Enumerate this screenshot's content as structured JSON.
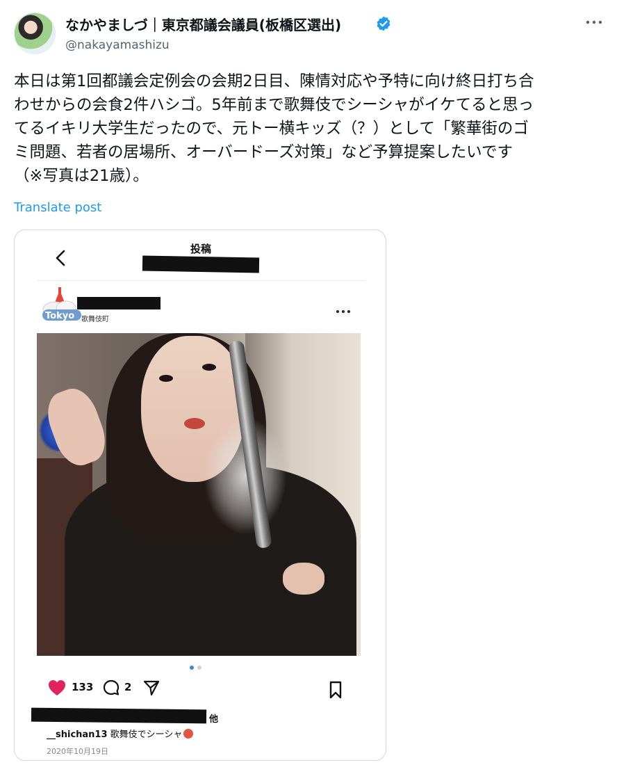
{
  "tweet": {
    "display_name": "なかやましづ｜東京都議会議員(板橋区選出)",
    "handle": "@nakayamashizu",
    "text_lines": [
      "本日は第1回都議会定例会の会期2日目、陳情対応や予特に向け終日打ち合",
      "わせからの会食2件ハシゴ。5年前まで歌舞伎でシーシャがイケてると思っ",
      "てるイキリ大学生だったので、元トー横キッズ（？）として「繁華街のゴ",
      "ミ問題、若者の居場所、オーバードーズ対策」など予算提案したいです",
      "（※写真は21歳）。"
    ],
    "translate_label": "Translate post",
    "verified_color": "#1d9bf0",
    "link_color": "#1d9bf0"
  },
  "embedded_post": {
    "header_title": "投稿",
    "location": "歌舞伎町",
    "logo_text": "Tokyo",
    "like_count": "133",
    "comment_count": "2",
    "likes_suffix": "他",
    "caption_user": "__shichan13",
    "caption_text": "歌舞伎でシーシャ",
    "date": "2020年10月19日",
    "carousel_active_index": 0,
    "carousel_count": 2,
    "heart_color": "#e0245e"
  },
  "icons": [
    "verified-badge-icon",
    "more-horizontal-icon",
    "back-chevron-icon",
    "heart-icon",
    "comment-icon",
    "share-icon",
    "bookmark-icon"
  ]
}
